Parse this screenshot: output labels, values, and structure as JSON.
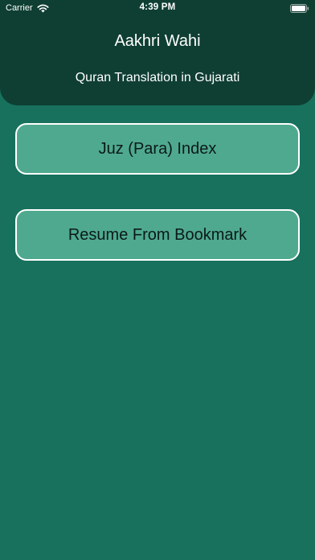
{
  "status_bar": {
    "carrier": "Carrier",
    "time": "4:39 PM",
    "wifi_icon": "wifi-icon",
    "battery_icon": "battery-icon"
  },
  "header": {
    "title": "Aakhri Wahi",
    "subtitle": "Quran Translation in Gujarati"
  },
  "buttons": {
    "juz_index": "Juz (Para) Index",
    "resume_bookmark": "Resume From Bookmark"
  },
  "colors": {
    "background": "#17715d",
    "header": "#0f3f33",
    "button": "#4fa98f",
    "button_border": "#ffffff"
  }
}
